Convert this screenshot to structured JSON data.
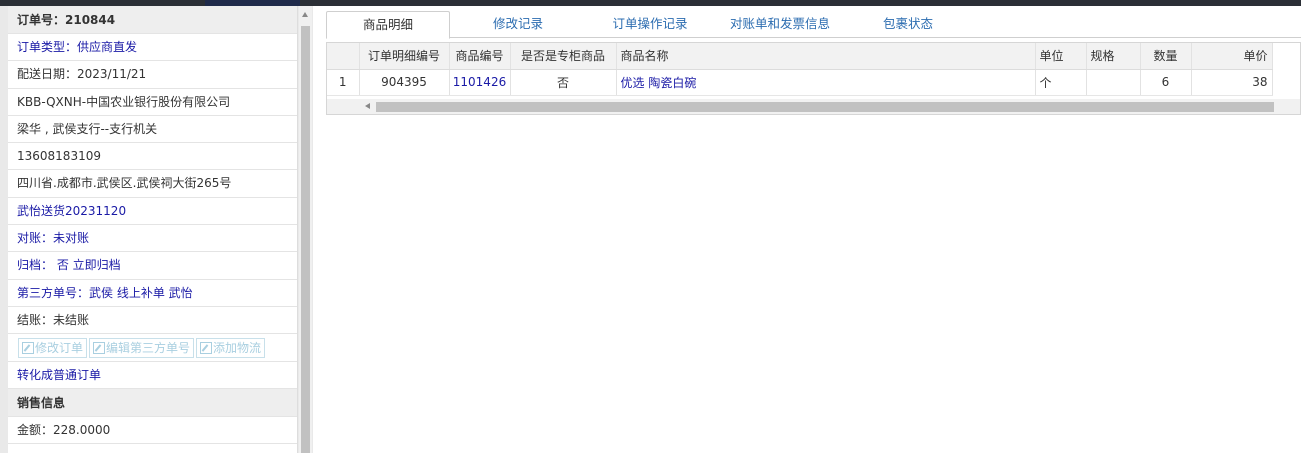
{
  "order_panel": {
    "order_no": "订单号：210844",
    "rows": [
      {
        "key": "order_type",
        "text": "订单类型：供应商直发",
        "link": true
      },
      {
        "key": "delivery_date",
        "text": "配送日期：2023/11/21",
        "link": false
      },
      {
        "key": "company",
        "text": "KBB-QXNH-中国农业银行股份有限公司",
        "link": false
      },
      {
        "key": "contact",
        "text": "梁华 , 武侯支行--支行机关",
        "link": false
      },
      {
        "key": "phone",
        "text": "13608183109",
        "link": false
      },
      {
        "key": "address",
        "text": "四川省.成都市.武侯区.武侯祠大街265号",
        "link": false
      },
      {
        "key": "remark",
        "text": "武怡送货20231120",
        "link": true
      },
      {
        "key": "reconcile",
        "text": "对账：未对账",
        "link": true
      },
      {
        "key": "archive",
        "text": "归档： 否 立即归档",
        "link": true
      },
      {
        "key": "third_party",
        "text": "第三方单号：武侯 线上补单 武怡",
        "link": true
      },
      {
        "key": "settle",
        "text": "结账：未结账",
        "link": false
      }
    ],
    "buttons": [
      "修改订单",
      "编辑第三方单号",
      "添加物流"
    ],
    "convert_link": "转化成普通订单",
    "sales_header": "销售信息",
    "amount": "金额：228.0000"
  },
  "tabs": [
    "商品明细",
    "修改记录",
    "订单操作记录",
    "对账单和发票信息",
    "包裹状态"
  ],
  "active_tab": 0,
  "table": {
    "columns": [
      "",
      "订单明细编号",
      "商品编号",
      "是否是专柜商品",
      "商品名称",
      "单位",
      "规格",
      "数量",
      "单价"
    ],
    "rows": [
      [
        "1",
        "904395",
        "1101426",
        "否",
        "优选 陶瓷白碗",
        "个",
        "",
        "6",
        "38"
      ]
    ]
  },
  "icons": {
    "edit_icon": "pencil-square-icon"
  }
}
